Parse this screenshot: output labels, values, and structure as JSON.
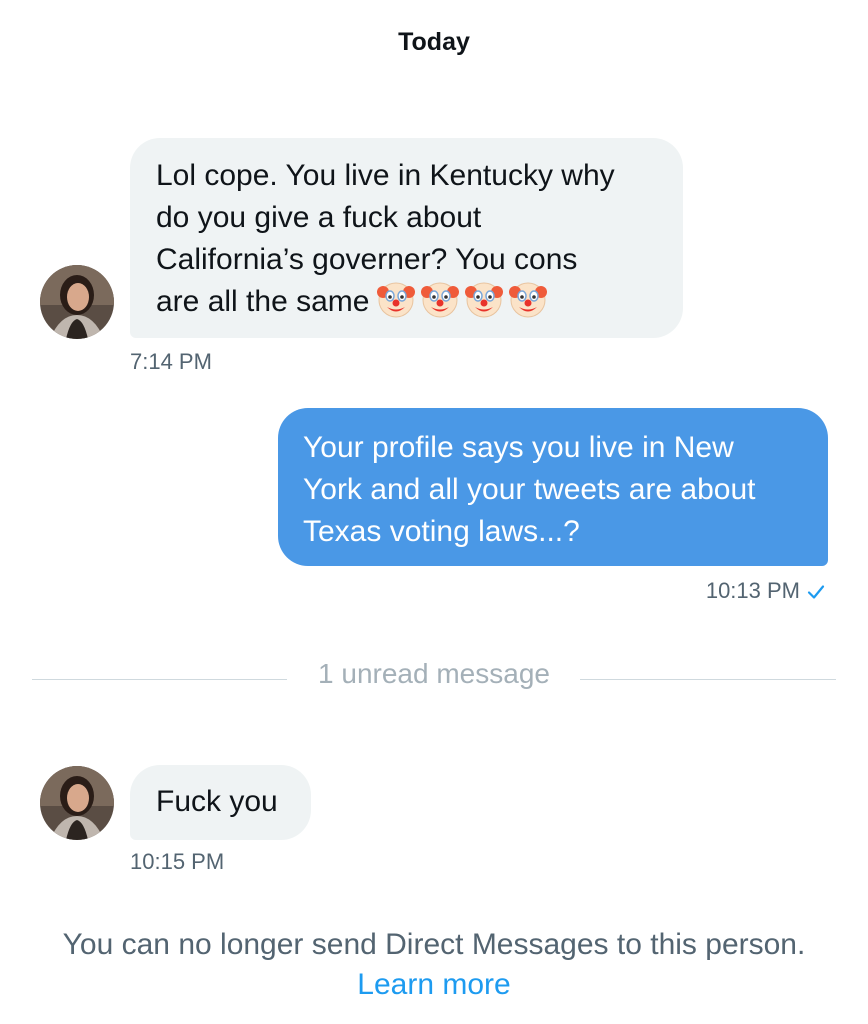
{
  "header": {
    "date_label": "Today"
  },
  "messages": [
    {
      "direction": "received",
      "lines": [
        "Lol cope. You live in Kentucky why",
        "do you give a fuck about",
        "California’s governer? You cons",
        "are all the same"
      ],
      "emoji": [
        "clown-face",
        "clown-face",
        "clown-face",
        "clown-face"
      ],
      "time": "7:14 PM"
    },
    {
      "direction": "sent",
      "lines": [
        "Your profile says you live in New",
        "York and all your tweets are about",
        "Texas voting laws...?"
      ],
      "time": "10:13 PM",
      "status": "read-check"
    },
    {
      "direction": "received",
      "lines": [
        "Fuck you"
      ],
      "time": "10:15 PM"
    }
  ],
  "unread_divider": {
    "label": "1 unread message"
  },
  "footer": {
    "notice": "You can no longer send Direct Messages to this person.",
    "link_label": "Learn more"
  },
  "colors": {
    "sent_bubble": "#4a98e6",
    "received_bubble": "#eff3f4",
    "link": "#1d9bf0",
    "secondary_text": "#536471"
  }
}
